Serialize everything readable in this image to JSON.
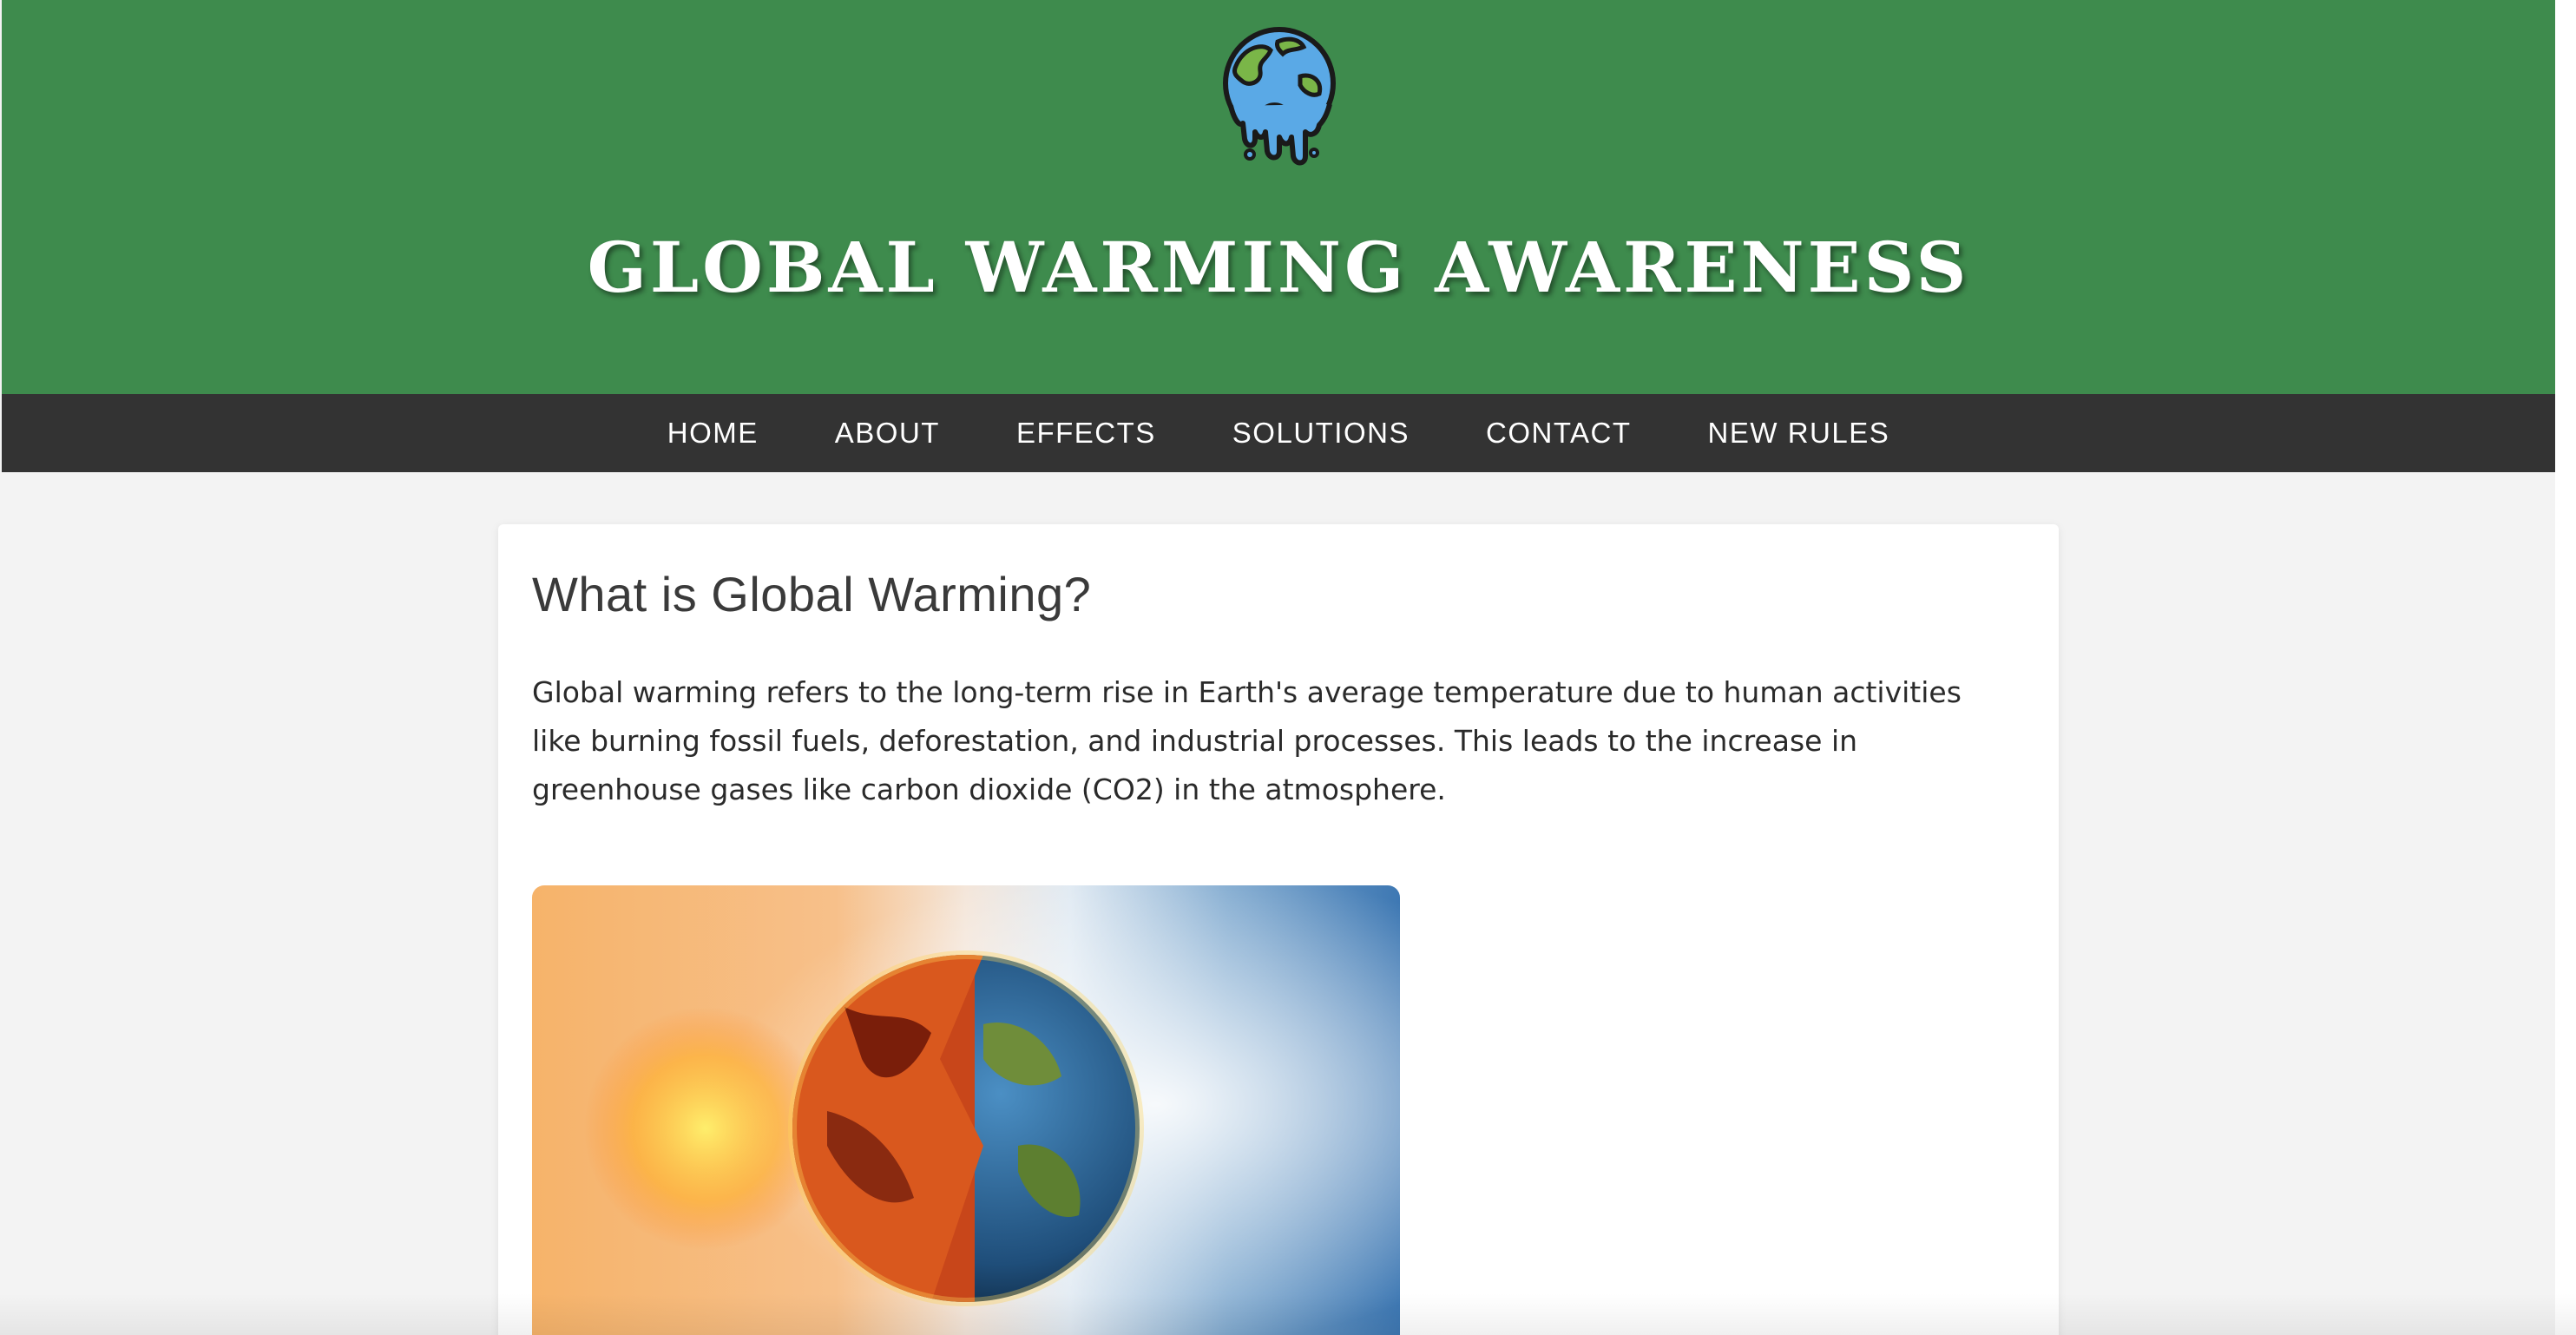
{
  "header": {
    "logo_icon": "melting-earth-icon",
    "title": "GLOBAL WARMING AWARENESS",
    "bg_color": "#3e8b4d"
  },
  "nav": {
    "bg_color": "#333333",
    "items": [
      {
        "label": "HOME"
      },
      {
        "label": "ABOUT"
      },
      {
        "label": "EFFECTS"
      },
      {
        "label": "SOLUTIONS"
      },
      {
        "label": "CONTACT"
      },
      {
        "label": "NEW RULES"
      }
    ]
  },
  "main": {
    "heading": "What is Global Warming?",
    "body": "Global warming refers to the long-term rise in Earth's average temperature due to human activities like burning fossil fuels, deforestation, and industrial processes. This leads to the increase in greenhouse gases like carbon dioxide (CO2) in the atmosphere.",
    "image_icon": "earth-half-fire-half-sky-image"
  }
}
